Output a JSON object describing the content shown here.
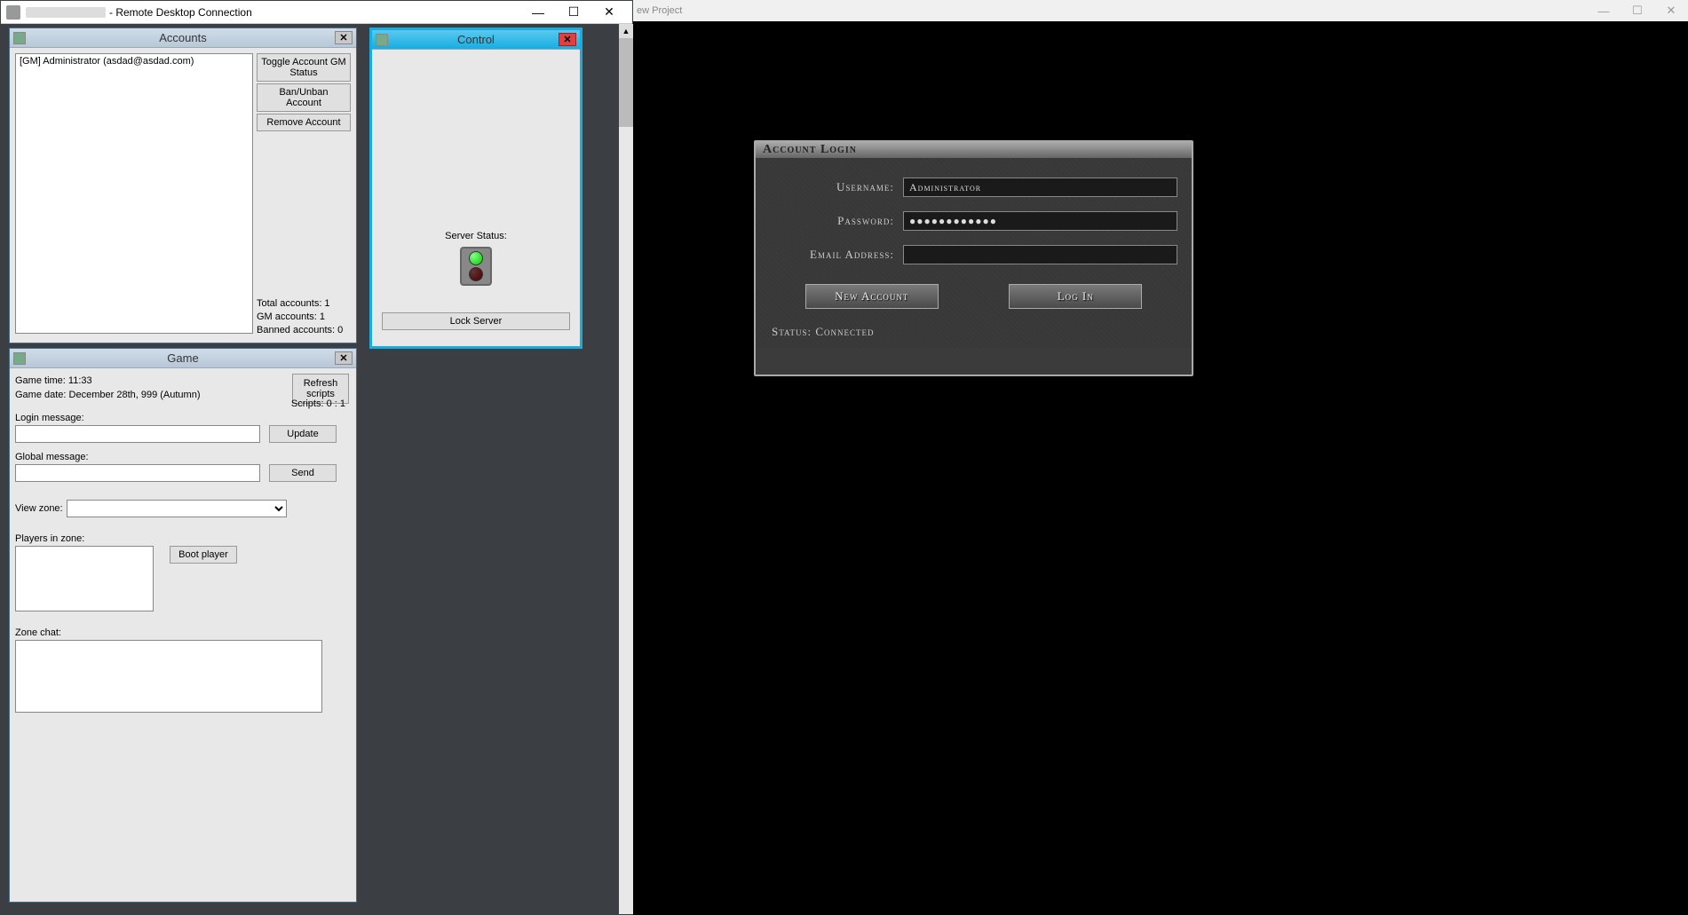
{
  "rdc": {
    "title_suffix": " - Remote Desktop Connection",
    "min": "—",
    "max": "☐",
    "close": "✕"
  },
  "bg_window": {
    "title": "ew Project",
    "min": "—",
    "max": "☐",
    "close": "✕"
  },
  "accounts": {
    "title": "Accounts",
    "close": "✕",
    "list_item": "[GM] Administrator  (asdad@asdad.com)",
    "btn_toggle": "Toggle Account GM Status",
    "btn_ban": "Ban/Unban Account",
    "btn_remove": "Remove Account",
    "stat_total": "Total accounts: 1",
    "stat_gm": "GM accounts: 1",
    "stat_banned": "Banned accounts: 0"
  },
  "control": {
    "title": "Control",
    "close": "✕",
    "status_label": "Server Status:",
    "lock_btn": "Lock Server"
  },
  "game": {
    "title": "Game",
    "close": "✕",
    "time": "Game time: 11:33",
    "date": "Game date: December 28th, 999  (Autumn)",
    "refresh": "Refresh scripts",
    "scripts": "Scripts: 0 : 1",
    "login_msg_label": "Login message:",
    "update": "Update",
    "global_msg_label": "Global message:",
    "send": "Send",
    "view_zone_label": "View zone:",
    "players_label": "Players in zone:",
    "boot": "Boot player",
    "zone_chat_label": "Zone chat:"
  },
  "login": {
    "title": "Account Login",
    "username_label": "Username:",
    "username_value": "Administrator",
    "password_label": "Password:",
    "password_value": "●●●●●●●●●●●●",
    "email_label": "Email Address:",
    "email_value": "",
    "btn_new": "New Account",
    "btn_login": "Log In",
    "status": "Status: Connected"
  }
}
